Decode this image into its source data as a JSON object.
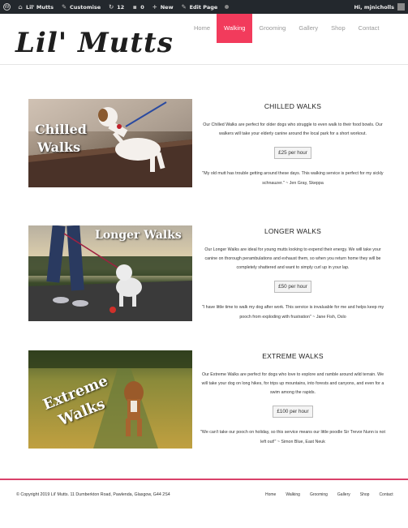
{
  "adminbar": {
    "site_name": "Lil' Mutts",
    "customise": "Customise",
    "updates": "12",
    "comments": "0",
    "new": "New",
    "edit_page": "Edit Page",
    "greeting": "Hi, mjnicholls"
  },
  "header": {
    "logo": "Lil' Mutts",
    "nav": [
      "Home",
      "Walking",
      "Grooming",
      "Gallery",
      "Shop",
      "Contact"
    ],
    "active_nav": "Walking"
  },
  "sections": [
    {
      "image_caption": [
        "Chilled",
        "Walks"
      ],
      "title": "CHILLED WALKS",
      "description": "Our Chilled Walks are perfect for older dogs who struggle to even walk to their food bowls. Our walkers will take your elderly canine around the local park for a short workout.",
      "price": "£25 per hour",
      "quote": "\"My old mutt has trouble getting around these days. This walking service is perfect for my sickly schnauzer.\" ~ Jen Gray, Skeppa"
    },
    {
      "image_caption": [
        "Longer Walks"
      ],
      "title": "LONGER WALKS",
      "description": "Our Longer Walks are ideal for young mutts looking to expend their energy. We will take your canine on thorough perambulations and exhaust them, so when you return home they will be completely shattered and want to simply curl up in your lap.",
      "price": "£50 per hour",
      "quote": "\"I have little time to walk my dog after work. This service is invaluable for me and helps keep my pooch from exploding with frustration\" ~ Jane Fish, Oslo"
    },
    {
      "image_caption": [
        "Extreme",
        "Walks"
      ],
      "title": "EXTREME WALKS",
      "description": "Our Extreme Walks are perfect for dogs who love to explore and ramble around wild terrain. We will take your dog on long hikes, for trips up mountains, into forests and canyons, and even for a swim among the rapids.",
      "price": "£100 per hour",
      "quote": "\"We can't take our pooch on holiday, so this service means our little poodle Sir Trevor Nunn is not left out!\" ~ Simon Blue, East Neuk"
    }
  ],
  "footer": {
    "copyright": "© Copyright 2019 Lil' Mutts. 11 Dumberkton Road, Pawlenda, Glasgow, G44 2S4",
    "nav": [
      "Home",
      "Walking",
      "Grooming",
      "Gallery",
      "Shop",
      "Contact"
    ]
  },
  "colors": {
    "accent": "#f23b5c",
    "adminbar": "#23282d",
    "footer_line": "#d9416a"
  }
}
